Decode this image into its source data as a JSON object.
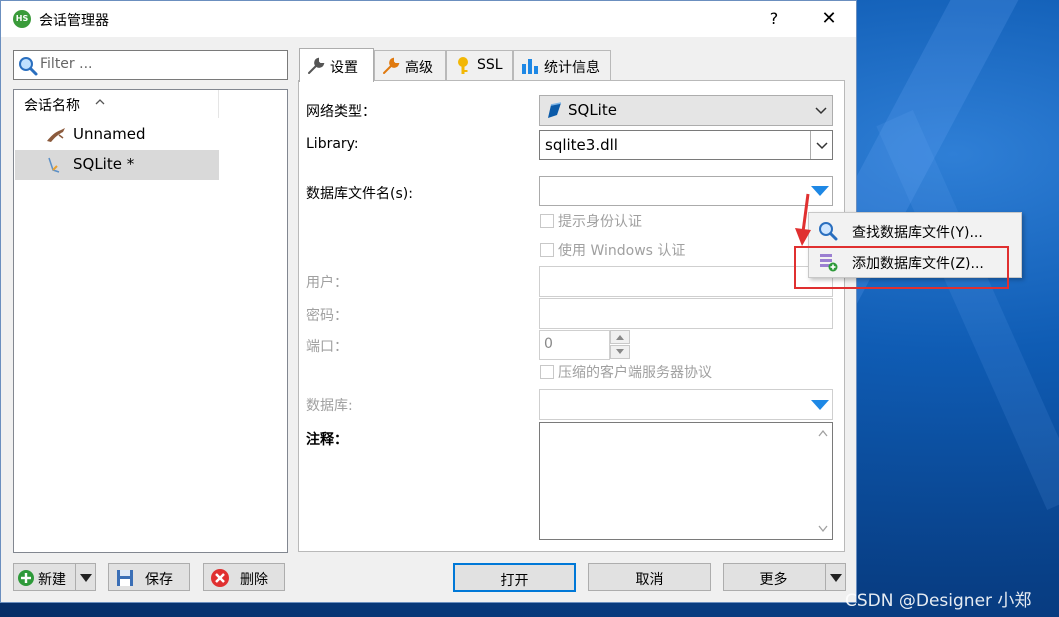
{
  "window": {
    "title": "会话管理器",
    "help_glyph": "?",
    "close_glyph": "✕",
    "app_icon_text": "HS"
  },
  "filter": {
    "placeholder": "Filter ..."
  },
  "session_list": {
    "header": "会话名称",
    "items": [
      {
        "label": "Unnamed",
        "selected": false
      },
      {
        "label": "SQLite *",
        "selected": true
      }
    ]
  },
  "tabs": [
    {
      "label": "设置",
      "active": true,
      "icon": "wrench-icon"
    },
    {
      "label": "高级",
      "active": false,
      "icon": "wrench-orange-icon"
    },
    {
      "label": "SSL",
      "active": false,
      "icon": "key-icon"
    },
    {
      "label": "统计信息",
      "active": false,
      "icon": "bar-chart-icon"
    }
  ],
  "settings": {
    "network_type_label": "网络类型：",
    "network_type_value": "SQLite",
    "library_label": "Library:",
    "library_value": "sqlite3.dll",
    "db_filename_label": "数据库文件名(s):",
    "db_filename_value": "",
    "prompt_auth_label": "提示身份认证",
    "windows_auth_label": "使用 Windows 认证",
    "user_label": "用户：",
    "password_label": "密码：",
    "port_label": "端口：",
    "port_value": "0",
    "compress_label": "压缩的客户端服务器协议",
    "database_label": "数据库:",
    "comment_label": "注释："
  },
  "context_menu": {
    "items": [
      {
        "label": "查找数据库文件(Y)...",
        "icon": "magnifier-icon"
      },
      {
        "label": "添加数据库文件(Z)...",
        "icon": "add-file-icon"
      }
    ]
  },
  "bottom_left": {
    "new_label": "新建",
    "save_label": "保存",
    "delete_label": "删除"
  },
  "bottom_right": {
    "open_label": "打开",
    "cancel_label": "取消",
    "more_label": "更多"
  },
  "watermark": "CSDN @Designer 小郑",
  "colors": {
    "accent": "#0078d7",
    "highlight_box": "#e03030",
    "dropdown_arrow": "#1e88e5"
  }
}
